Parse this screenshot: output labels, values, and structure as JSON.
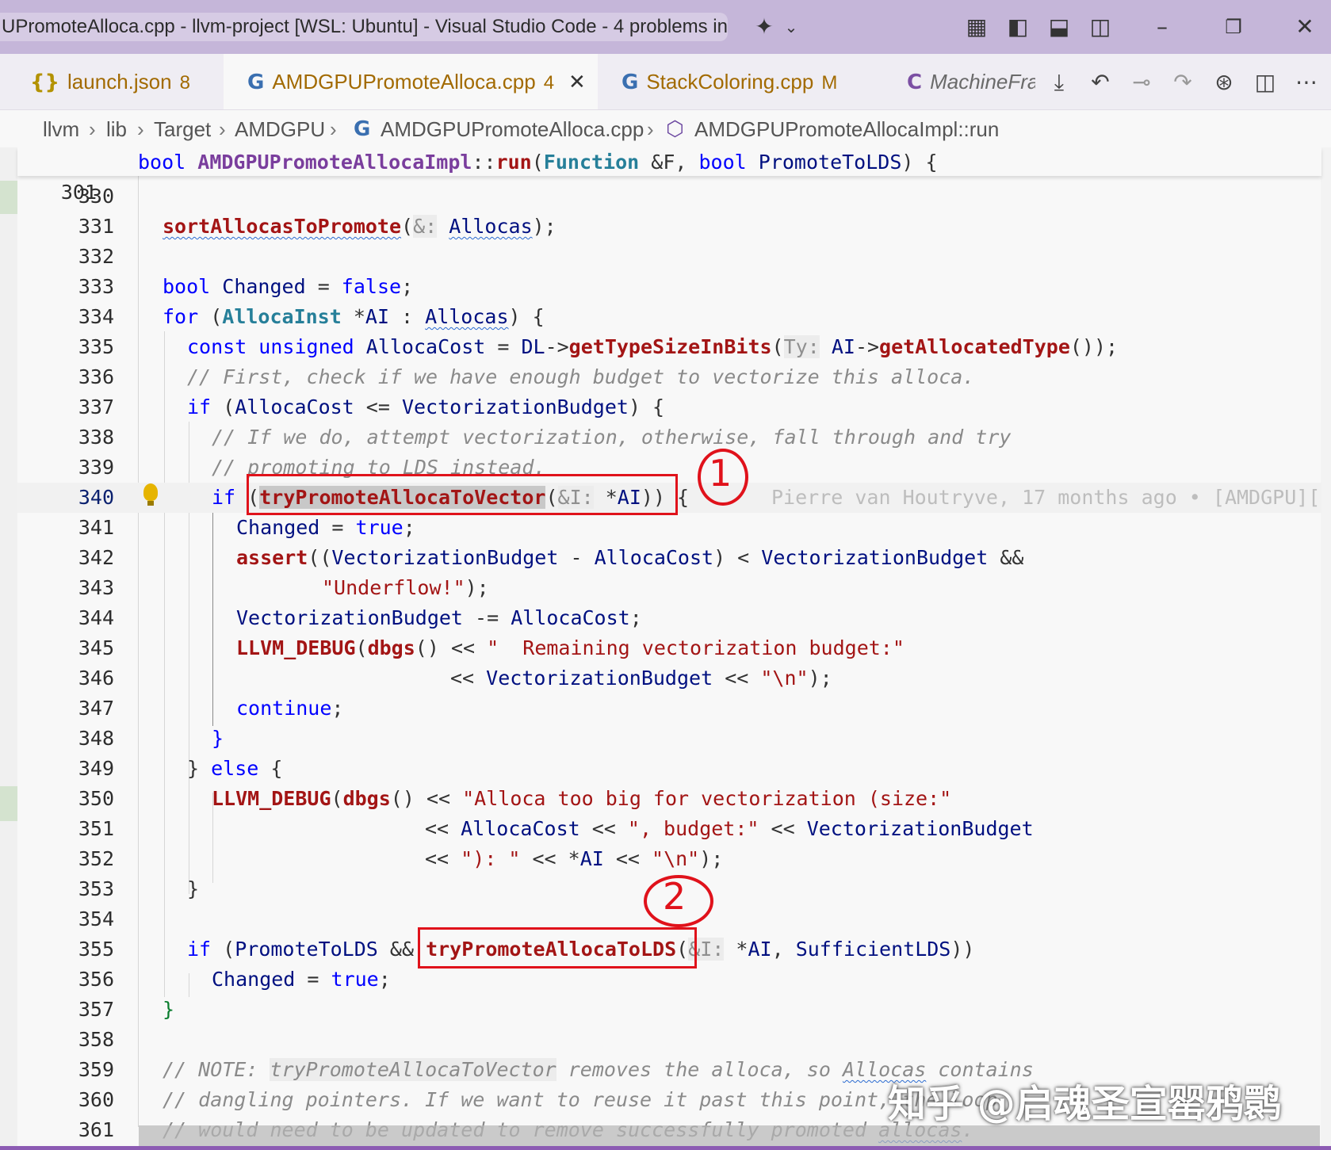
{
  "window": {
    "title": "UPromoteAlloca.cpp - llvm-project [WSL: Ubuntu] - Visual Studio Code - 4 problems in",
    "icons": [
      "copilot-icon",
      "chevron-down-icon",
      "customize-layout-icon",
      "toggle-sidebar-icon",
      "toggle-panel-icon",
      "toggle-secondary-sidebar-icon",
      "minimize-icon",
      "restore-icon",
      "close-icon"
    ]
  },
  "tabs": [
    {
      "icon": "{}",
      "label": "launch.json",
      "badge": "8"
    },
    {
      "icon": "G",
      "label": "AMDGPUPromoteAlloca.cpp",
      "badge": "4",
      "close": "✕"
    },
    {
      "icon": "G",
      "label": "StackColoring.cpp",
      "badge": "M"
    },
    {
      "icon": "C",
      "label": "MachineFra"
    }
  ],
  "breadcrumb": [
    "llvm",
    "lib",
    "Target",
    "AMDGPU",
    "AMDGPUPromoteAlloca.cpp",
    "AMDGPUPromoteAllocaImpl::run"
  ],
  "sticky": {
    "ln": "301",
    "bool": "bool",
    "cls": "AMDGPUPromoteAllocaImpl",
    "sep": "::",
    "fn": "run",
    "p1": "(",
    "t1": "Function",
    "p2": " &F, ",
    "t2": "bool",
    "p3": " ",
    "v1": "PromoteToLDS",
    "p4": ") {"
  },
  "lines": {
    "l330": "330",
    "l331": "331",
    "l332": "332",
    "l333": "333",
    "l334": "334",
    "l335": "335",
    "l336": "336",
    "l337": "337",
    "l338": "338",
    "l339": "339",
    "l340": "340",
    "l341": "341",
    "l342": "342",
    "l343": "343",
    "l344": "344",
    "l345": "345",
    "l346": "346",
    "l347": "347",
    "l348": "348",
    "l349": "349",
    "l350": "350",
    "l351": "351",
    "l352": "352",
    "l353": "353",
    "l354": "354",
    "l355": "355",
    "l356": "356",
    "l357": "357",
    "l358": "358",
    "l359": "359",
    "l360": "360",
    "l361": "361"
  },
  "code": {
    "c331a": "sortAllocasToPromote",
    "c331b": "(",
    "c331h": "&:",
    "c331c": " ",
    "c331d": "Allocas",
    "c331e": ");",
    "c333a": "bool",
    "c333b": " ",
    "c333c": "Changed",
    "c333d": " = ",
    "c333e": "false",
    "c333f": ";",
    "c334a": "for",
    "c334b": " (",
    "c334c": "AllocaInst",
    "c334d": " *",
    "c334e": "AI",
    "c334f": " : ",
    "c334g": "Allocas",
    "c334h": ") {",
    "c335a": "const unsigned",
    "c335b": " ",
    "c335c": "AllocaCost",
    "c335d": " = ",
    "c335e": "DL",
    "c335f": "->",
    "c335g": "getTypeSizeInBits",
    "c335h": "(",
    "c335i": "Ty:",
    "c335j": " ",
    "c335k": "AI",
    "c335l": "->",
    "c335m": "getAllocatedType",
    "c335n": "());",
    "c336": "// First, check if we have enough budget to vectorize this alloca.",
    "c337a": "if",
    "c337b": " (",
    "c337c": "AllocaCost",
    "c337d": " <= ",
    "c337e": "VectorizationBudget",
    "c337f": ") {",
    "c338": "// If we do, attempt vectorization, otherwise, fall through and try",
    "c339": "// promoting to LDS instead.",
    "c340a": "if",
    "c340b": " (",
    "c340c": "tryPromoteAllocaToVector",
    "c340d": "(",
    "c340h": "&I:",
    "c340e": " *",
    "c340f": "AI",
    "c340g": ")) {",
    "c340blame": "Pierre van Houtryve, 17 months ago • [AMDGPU][",
    "c341a": "Changed",
    "c341b": " = ",
    "c341c": "true",
    "c341d": ";",
    "c342a": "assert",
    "c342b": "((",
    "c342c": "VectorizationBudget",
    "c342d": " - ",
    "c342e": "AllocaCost",
    "c342f": ") < ",
    "c342g": "VectorizationBudget",
    "c342h": " &&",
    "c343a": "\"Underflow!\"",
    "c343b": ");",
    "c344a": "VectorizationBudget",
    "c344b": " -= ",
    "c344c": "AllocaCost",
    "c344d": ";",
    "c345a": "LLVM_DEBUG",
    "c345b": "(",
    "c345c": "dbgs",
    "c345d": "() << ",
    "c345e": "\"  Remaining vectorization budget:\"",
    "c346a": "<< ",
    "c346b": "VectorizationBudget",
    "c346c": " << ",
    "c346d": "\"\\n\"",
    "c346e": ");",
    "c347a": "continue",
    "c347b": ";",
    "c348": "}",
    "c349a": "} ",
    "c349b": "else",
    "c349c": " {",
    "c350a": "LLVM_DEBUG",
    "c350b": "(",
    "c350c": "dbgs",
    "c350d": "() << ",
    "c350e": "\"Alloca too big for vectorization (size:\"",
    "c351a": "<< ",
    "c351b": "AllocaCost",
    "c351c": " << ",
    "c351d": "\", budget:\"",
    "c351e": " << ",
    "c351f": "VectorizationBudget",
    "c352a": "<< ",
    "c352b": "\"): \"",
    "c352c": " << *",
    "c352d": "AI",
    "c352e": " << ",
    "c352f": "\"\\n\"",
    "c352g": ");",
    "c353": "}",
    "c355a": "if",
    "c355b": " (",
    "c355c": "PromoteToLDS",
    "c355d": " && ",
    "c355e": "tryPromoteAllocaToLDS",
    "c355f": "(",
    "c355h": "&I:",
    "c355i": " *",
    "c355j": "AI",
    "c355k": ", ",
    "c355l": "SufficientLDS",
    "c355m": "))",
    "c356a": "Changed",
    "c356b": " = ",
    "c356c": "true",
    "c356d": ";",
    "c357": "}",
    "c359a": "// NOTE: ",
    "c359b": "tryPromoteAllocaToVector",
    "c359c": " removes the alloca, so ",
    "c359d": "Allocas",
    "c359e": " contains",
    "c360": "// dangling pointers. If we want to reuse it past this point, the loop",
    "c361a": "// would need to be updated to remove successfully promoted ",
    "c361b": "allocas",
    "c361c": "."
  },
  "annotations": {
    "one": "1",
    "two": "2"
  },
  "watermark": "知乎 @启魂圣宣罂鸦鹮"
}
